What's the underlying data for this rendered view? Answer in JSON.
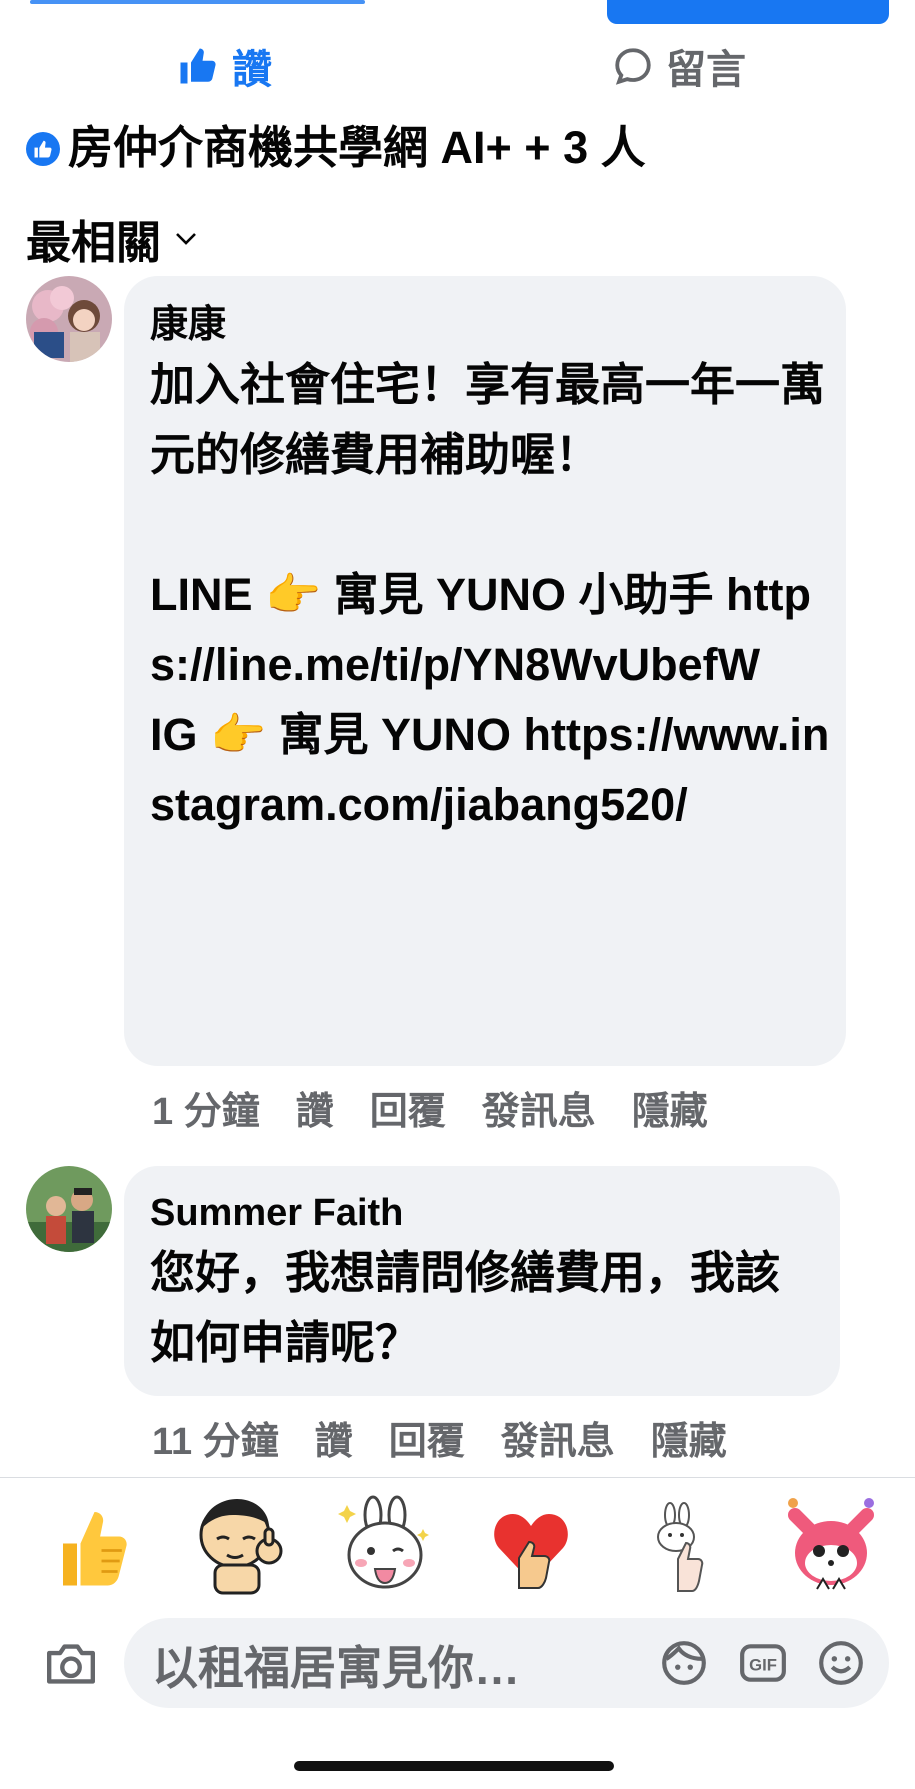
{
  "actions": {
    "like_label": "讚",
    "comment_label": "留言",
    "like_icon": "thumbs-up-icon",
    "comment_icon": "speech-bubble-icon"
  },
  "filter": {
    "page_name": "房仲介商機共學網 AI+ + 3 人",
    "sort_label": "最相關"
  },
  "comments": [
    {
      "author": "康康",
      "text": "加入社會住宅！享有最高一年一萬元的修繕費用補助喔！\n\nLINE 👉 寓見 YUNO 小助手 https://line.me/ti/p/YN8WvUbefW\nIG 👉 寓見 YUNO https://www.instagram.com/jiabang520/",
      "time": "1 分鐘",
      "like": "讚",
      "reply": "回覆",
      "message": "發訊息",
      "hide": "隱藏"
    },
    {
      "author": "Summer Faith",
      "text": "您好，我想請問修繕費用，我該如何申請呢？",
      "time": "11 分鐘",
      "like": "讚",
      "reply": "回覆",
      "message": "發訊息",
      "hide": "隱藏"
    }
  ],
  "stickers": [
    "thumbs-up-emoji",
    "cartoon-boy-thumbs-up-sticker",
    "bunny-thumbs-up-sticker",
    "heart-hand-sticker",
    "small-bunny-thumbs-up-sticker",
    "pink-fox-sticker"
  ],
  "composer": {
    "placeholder": "以租福居寓見你…",
    "camera_icon": "camera-icon",
    "avatar_icon": "avatar-sticker-icon",
    "gif_label": "GIF",
    "emoji_icon": "smiley-icon"
  },
  "colors": {
    "accent": "#1877f2",
    "bubble": "#f0f2f5",
    "secondary_text": "#65676b"
  }
}
